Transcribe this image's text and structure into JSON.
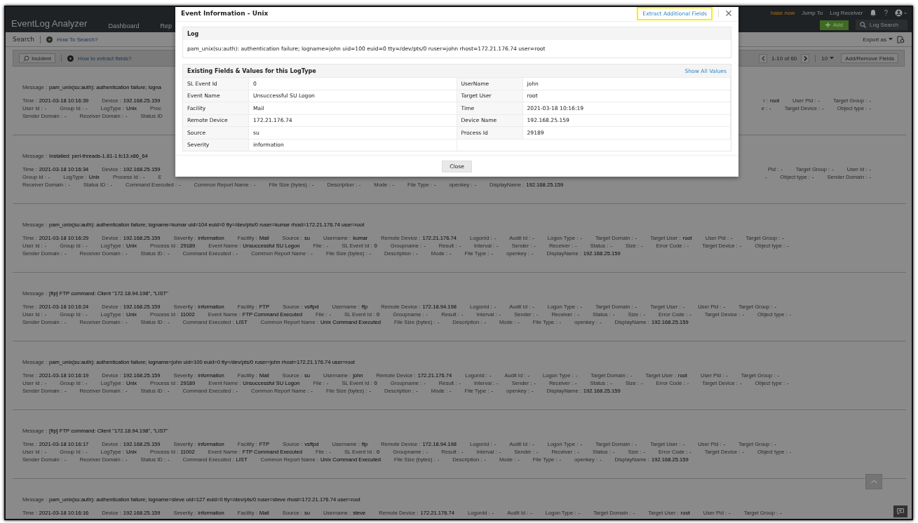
{
  "header": {
    "logo": "EventLog Analyzer",
    "nav": [
      {
        "label": "Dashboard",
        "selected": false
      },
      {
        "label": "Rep",
        "selected": false
      }
    ],
    "purchase": "hase now",
    "links": [
      "Jump To",
      "Log Receiver"
    ],
    "help": "?",
    "add_button": "Add",
    "search": {
      "placeholder": "Log Search"
    }
  },
  "search_bar": {
    "title": "Search",
    "help_link": "How To Search?",
    "export": "Export as"
  },
  "toolbar": {
    "incident": "Incident",
    "help_link": "How to extract fields?",
    "pager": "1-10 of 60",
    "page_size": "10",
    "fields_button": "Add/Remove Fields"
  },
  "events": [
    {
      "message_label": "Message :",
      "message": "pam_unix(su:auth): authentication failure; logna",
      "lines": [
        [
          [
            {
              "label": "Time :",
              "value": "2021-03-18 10:16:39"
            },
            {
              "label": "Device :",
              "value": "192.168.25.159"
            }
          ],
          [
            {
              "label": "r :",
              "value": "root"
            },
            {
              "label": "User Pid :",
              "value": "-"
            },
            {
              "label": "Target Group :",
              "value": "-"
            }
          ]
        ],
        [
          [
            {
              "label": "User Id :",
              "value": "-"
            },
            {
              "label": "Group Id :",
              "value": "-"
            },
            {
              "label": "LogType :",
              "value": "Unix"
            },
            {
              "label": "Proc"
            }
          ],
          [
            {
              "label": "e :",
              "value": "-"
            },
            {
              "label": "Target Device :",
              "value": "-"
            },
            {
              "label": "Object type :",
              "value": "-"
            }
          ]
        ],
        [
          [
            {
              "label": "Sender Domain :",
              "value": "-"
            },
            {
              "label": "Receiver Domain :",
              "value": "-"
            },
            {
              "label": "Status ID"
            }
          ]
        ]
      ]
    },
    {
      "message_label": "Message :",
      "message": "Installed: perl-threads-1.81-1.fc13.x86_64",
      "lines": [
        [
          [
            {
              "label": "Time :",
              "value": "2021-03-18 10:16:34"
            },
            {
              "label": "Device :",
              "value": "192.168.25.159"
            }
          ],
          [
            {
              "label": "Pid :",
              "value": "-"
            },
            {
              "label": "Target Group :",
              "value": "-"
            },
            {
              "label": "User Id :",
              "value": "-"
            }
          ]
        ],
        [
          [
            {
              "label": "Group Id :",
              "value": "-"
            },
            {
              "label": "LogType :",
              "value": "Unix"
            },
            {
              "label": "Process Id :",
              "value": "-"
            },
            {
              "label": "E"
            }
          ],
          [
            {
              "value": "-"
            },
            {
              "label": "Object type :",
              "value": "-"
            },
            {
              "label": "Sender Domain :",
              "value": "-"
            }
          ]
        ],
        [
          [
            {
              "label": "Receiver Domain :",
              "value": "-"
            },
            {
              "label": "Status ID :",
              "value": "-"
            },
            {
              "label": "Command Executed :",
              "value": "-"
            },
            {
              "label": "Common Report Name :",
              "value": "-"
            },
            {
              "label": "File Size (bytes) :",
              "value": "-"
            },
            {
              "label": "Description :",
              "value": "-"
            },
            {
              "label": "Mode :",
              "value": "-"
            },
            {
              "label": "File Type :",
              "value": "-"
            },
            {
              "label": "openkey :",
              "value": "-"
            },
            {
              "label": "DisplayName :",
              "value": "192.168.25.159"
            }
          ]
        ]
      ]
    },
    {
      "message_label": "Message :",
      "message": "pam_unix(su:auth): authentication failure; logname=kumar uid=104 euid=0 tty=/dev/pts/0 ruser=kumar rhost=172.21.176.74 user=root",
      "lines": [
        [
          [
            {
              "label": "Time :",
              "value": "2021-03-18 10:16:29"
            },
            {
              "label": "Device :",
              "value": "192.168.25.159"
            },
            {
              "label": "Severity :",
              "value": "information"
            },
            {
              "label": "Facility :",
              "value": "Mail"
            },
            {
              "label": "Source :",
              "value": "su"
            },
            {
              "label": "Username :",
              "value": "kumar"
            },
            {
              "label": "Remote Device :",
              "value": "172.21.176.74"
            },
            {
              "label": "LogonId :",
              "value": "-"
            },
            {
              "label": "Audit Id :",
              "value": "-"
            },
            {
              "label": "Logon Type :",
              "value": "-"
            },
            {
              "label": "Target Domain :",
              "value": "-"
            },
            {
              "label": "Target User :",
              "value": "root"
            },
            {
              "label": "User Pid :",
              "value": "-"
            },
            {
              "label": "Target Group :",
              "value": "-"
            }
          ]
        ],
        [
          [
            {
              "label": "User Id :",
              "value": "-"
            },
            {
              "label": "Group Id :",
              "value": "-"
            },
            {
              "label": "LogType :",
              "value": "Unix"
            },
            {
              "label": "Process Id :",
              "value": "29189"
            },
            {
              "label": "Event Name :",
              "value": "Unsuccessful SU Logon"
            },
            {
              "label": "File :",
              "value": "-"
            },
            {
              "label": "SL Event Id :",
              "value": "0"
            },
            {
              "label": "Groupname :",
              "value": "-"
            },
            {
              "label": "Result :",
              "value": "-"
            },
            {
              "label": "Interval :",
              "value": "-"
            },
            {
              "label": "Sender :",
              "value": "-"
            },
            {
              "label": "Receiver :",
              "value": "-"
            },
            {
              "label": "Status :",
              "value": "-"
            },
            {
              "label": "Size :",
              "value": "-"
            },
            {
              "label": "Error Code :",
              "value": "-"
            },
            {
              "label": "Target Device :",
              "value": "-"
            },
            {
              "label": "Object type :",
              "value": "-"
            }
          ]
        ],
        [
          [
            {
              "label": "Sender Domain :",
              "value": "-"
            },
            {
              "label": "Receiver Domain :",
              "value": "-"
            },
            {
              "label": "Status ID :",
              "value": "-"
            },
            {
              "label": "Command Executed :",
              "value": "-"
            },
            {
              "label": "Common Report Name :",
              "value": "-"
            },
            {
              "label": "File Size (bytes) :",
              "value": "-"
            },
            {
              "label": "Description :",
              "value": "-"
            },
            {
              "label": "Mode :",
              "value": "-"
            },
            {
              "label": "File Type :",
              "value": "-"
            },
            {
              "label": "openkey :",
              "value": "-"
            },
            {
              "label": "DisplayName :",
              "value": "192.168.25.159"
            }
          ]
        ]
      ]
    },
    {
      "message_label": "Message :",
      "message": "[ftp] FTP command: Client \"172.18.94.198\", \"LIST\"",
      "lines": [
        [
          [
            {
              "label": "Time :",
              "value": "2021-03-18 10:16:24"
            },
            {
              "label": "Device :",
              "value": "192.168.25.159"
            },
            {
              "label": "Severity :",
              "value": "information"
            },
            {
              "label": "Facility :",
              "value": "FTP"
            },
            {
              "label": "Source :",
              "value": "vsftpd"
            },
            {
              "label": "Username :",
              "value": "ftp"
            },
            {
              "label": "Remote Device :",
              "value": "172.18.94.198"
            },
            {
              "label": "LogonId :",
              "value": "-"
            },
            {
              "label": "Audit Id :",
              "value": "-"
            },
            {
              "label": "Logon Type :",
              "value": "-"
            },
            {
              "label": "Target Domain :",
              "value": "-"
            },
            {
              "label": "Target User :",
              "value": "-"
            },
            {
              "label": "User Pid :",
              "value": "-"
            },
            {
              "label": "Target Group :",
              "value": "-"
            }
          ]
        ],
        [
          [
            {
              "label": "User Id :",
              "value": "-"
            },
            {
              "label": "Group Id :",
              "value": "-"
            },
            {
              "label": "LogType :",
              "value": "Unix"
            },
            {
              "label": "Process Id :",
              "value": "11002"
            },
            {
              "label": "Event Name :",
              "value": "FTP Command Executed"
            },
            {
              "label": "File :",
              "value": "-"
            },
            {
              "label": "SL Event Id :",
              "value": "0"
            },
            {
              "label": "Groupname :",
              "value": "-"
            },
            {
              "label": "Result :",
              "value": "-"
            },
            {
              "label": "Interval :",
              "value": "-"
            },
            {
              "label": "Sender :",
              "value": "-"
            },
            {
              "label": "Receiver :",
              "value": "-"
            },
            {
              "label": "Status :",
              "value": "-"
            },
            {
              "label": "Size :",
              "value": "-"
            },
            {
              "label": "Error Code :",
              "value": "-"
            },
            {
              "label": "Target Device :",
              "value": "-"
            },
            {
              "label": "Object type :",
              "value": "-"
            }
          ]
        ],
        [
          [
            {
              "label": "Sender Domain :",
              "value": "-"
            },
            {
              "label": "Receiver Domain :",
              "value": "-"
            },
            {
              "label": "Status ID :",
              "value": "-"
            },
            {
              "label": "Command Executed :",
              "value": "LIST"
            },
            {
              "label": "Common Report Name :",
              "value": "Unix Command Executed"
            },
            {
              "label": "File Size (bytes) :",
              "value": "-"
            },
            {
              "label": "Description :",
              "value": "-"
            },
            {
              "label": "Mode :",
              "value": "-"
            },
            {
              "label": "File Type :",
              "value": "-"
            },
            {
              "label": "openkey :",
              "value": "-"
            },
            {
              "label": "DisplayName :",
              "value": "192.168.25.159"
            }
          ]
        ]
      ]
    },
    {
      "message_label": "Message :",
      "message": "pam_unix(su:auth): authentication failure; logname=john uid=100 euid=0 tty=/dev/pts/0 ruser=john rhost=172.21.176.74 user=root",
      "lines": [
        [
          [
            {
              "label": "Time :",
              "value": "2021-03-18 10:16:19"
            },
            {
              "label": "Device :",
              "value": "192.168.25.159"
            },
            {
              "label": "Severity :",
              "value": "information"
            },
            {
              "label": "Facility :",
              "value": "Mail"
            },
            {
              "label": "Source :",
              "value": "su"
            },
            {
              "label": "Username :",
              "value": "john"
            },
            {
              "label": "Remote Device :",
              "value": "172.21.176.74"
            },
            {
              "label": "LogonId :",
              "value": "-"
            },
            {
              "label": "Audit Id :",
              "value": "-"
            },
            {
              "label": "Logon Type :",
              "value": "-"
            },
            {
              "label": "Target Domain :",
              "value": "-"
            },
            {
              "label": "Target User :",
              "value": "root"
            },
            {
              "label": "User Pid :",
              "value": "-"
            },
            {
              "label": "Target Group :",
              "value": "-"
            }
          ]
        ],
        [
          [
            {
              "label": "User Id :",
              "value": "-"
            },
            {
              "label": "Group Id :",
              "value": "-"
            },
            {
              "label": "LogType :",
              "value": "Unix"
            },
            {
              "label": "Process Id :",
              "value": "29189"
            },
            {
              "label": "Event Name :",
              "value": "Unsuccessful SU Logon"
            },
            {
              "label": "File :",
              "value": "-"
            },
            {
              "label": "SL Event Id :",
              "value": "0"
            },
            {
              "label": "Groupname :",
              "value": "-"
            },
            {
              "label": "Result :",
              "value": "-"
            },
            {
              "label": "Interval :",
              "value": "-"
            },
            {
              "label": "Sender :",
              "value": "-"
            },
            {
              "label": "Receiver :",
              "value": "-"
            },
            {
              "label": "Status :",
              "value": "-"
            },
            {
              "label": "Size :",
              "value": "-"
            },
            {
              "label": "Error Code :",
              "value": "-"
            },
            {
              "label": "Target Device :",
              "value": "-"
            },
            {
              "label": "Object type :",
              "value": "-"
            }
          ]
        ],
        [
          [
            {
              "label": "Sender Domain :",
              "value": "-"
            },
            {
              "label": "Receiver Domain :",
              "value": "-"
            },
            {
              "label": "Status ID :",
              "value": "-"
            },
            {
              "label": "Command Executed :",
              "value": "-"
            },
            {
              "label": "Common Report Name :",
              "value": "-"
            },
            {
              "label": "File Size (bytes) :",
              "value": "-"
            },
            {
              "label": "Description :",
              "value": "-"
            },
            {
              "label": "Mode :",
              "value": "-"
            },
            {
              "label": "File Type :",
              "value": "-"
            },
            {
              "label": "openkey :",
              "value": "-"
            },
            {
              "label": "DisplayName :",
              "value": "192.168.25.159"
            }
          ]
        ]
      ]
    },
    {
      "message_label": "Message :",
      "message": "[ftp] FTP command: Client \"172.18.94.198\", \"LIST\"",
      "lines": [
        [
          [
            {
              "label": "Time :",
              "value": "2021-03-18 10:16:17"
            },
            {
              "label": "Device :",
              "value": "192.168.25.159"
            },
            {
              "label": "Severity :",
              "value": "information"
            },
            {
              "label": "Facility :",
              "value": "FTP"
            },
            {
              "label": "Source :",
              "value": "vsftpd"
            },
            {
              "label": "Username :",
              "value": "ftp"
            },
            {
              "label": "Remote Device :",
              "value": "172.18.94.198"
            },
            {
              "label": "LogonId :",
              "value": "-"
            },
            {
              "label": "Audit Id :",
              "value": "-"
            },
            {
              "label": "Logon Type :",
              "value": "-"
            },
            {
              "label": "Target Domain :",
              "value": "-"
            },
            {
              "label": "Target User :",
              "value": "-"
            },
            {
              "label": "User Pid :",
              "value": "-"
            },
            {
              "label": "Target Group :",
              "value": "-"
            }
          ]
        ],
        [
          [
            {
              "label": "User Id :",
              "value": "-"
            },
            {
              "label": "Group Id :",
              "value": "-"
            },
            {
              "label": "LogType :",
              "value": "Unix"
            },
            {
              "label": "Process Id :",
              "value": "11002"
            },
            {
              "label": "Event Name :",
              "value": "FTP Command Executed"
            },
            {
              "label": "File :",
              "value": "-"
            },
            {
              "label": "SL Event Id :",
              "value": "0"
            },
            {
              "label": "Groupname :",
              "value": "-"
            },
            {
              "label": "Result :",
              "value": "-"
            },
            {
              "label": "Interval :",
              "value": "-"
            },
            {
              "label": "Sender :",
              "value": "-"
            },
            {
              "label": "Receiver :",
              "value": "-"
            },
            {
              "label": "Status :",
              "value": "-"
            },
            {
              "label": "Size :",
              "value": "-"
            },
            {
              "label": "Error Code :",
              "value": "-"
            },
            {
              "label": "Target Device :",
              "value": "-"
            },
            {
              "label": "Object type :",
              "value": "-"
            }
          ]
        ],
        [
          [
            {
              "label": "Sender Domain :",
              "value": "-"
            },
            {
              "label": "Receiver Domain :",
              "value": "-"
            },
            {
              "label": "Status ID :",
              "value": "-"
            },
            {
              "label": "Command Executed :",
              "value": "LIST"
            },
            {
              "label": "Common Report Name :",
              "value": "Unix Command Executed"
            },
            {
              "label": "File Size (bytes) :",
              "value": "-"
            },
            {
              "label": "Description :",
              "value": "-"
            },
            {
              "label": "Mode :",
              "value": "-"
            },
            {
              "label": "File Type :",
              "value": "-"
            },
            {
              "label": "openkey :",
              "value": "-"
            },
            {
              "label": "DisplayName :",
              "value": "192.168.25.159"
            }
          ]
        ]
      ]
    },
    {
      "message_label": "Message :",
      "message": "pam_unix(su:auth): authentication failure; logname=steve uid=127 euid=0 tty=/dev/pts/0 ruser=steve rhost=172.21.176.74 user=root",
      "lines": [
        [
          [
            {
              "label": "Time :",
              "value": "2021-03-18 10:16:16"
            },
            {
              "label": "Device :",
              "value": "192.168.25.159"
            },
            {
              "label": "Severity :",
              "value": "information"
            },
            {
              "label": "Facility :",
              "value": "Mail"
            },
            {
              "label": "Source :",
              "value": "su"
            },
            {
              "label": "Username :",
              "value": "steve"
            },
            {
              "label": "Remote Device :",
              "value": "172.21.176.74"
            },
            {
              "label": "LogonId :",
              "value": "-"
            },
            {
              "label": "Audit Id :",
              "value": "-"
            },
            {
              "label": "Logon Type :",
              "value": "-"
            },
            {
              "label": "Target Domain :",
              "value": "-"
            },
            {
              "label": "Target User :",
              "value": "root"
            },
            {
              "label": "User Pid :",
              "value": "-"
            },
            {
              "label": "Target Group :",
              "value": "-"
            }
          ]
        ]
      ]
    }
  ],
  "modal": {
    "title": "Event Information - Unix",
    "extract_link": {
      "label": "Extract Additional Fields",
      "highlighted": true
    },
    "log": {
      "title": "Log",
      "text": "pam_unix(su:auth): authentication failure; logname=john uid=100 euid=0 tty=/dev/pts/0 ruser=john rhost=172.21.176.74 user=root"
    },
    "fields_title": "Existing Fields & Values for this LogType",
    "show_all_link": "Show All Values",
    "fields": [
      {
        "label": "SL Event Id",
        "value": "0"
      },
      {
        "label": "UserName",
        "value": "john"
      },
      {
        "label": "Event Name",
        "value": "Unsuccessful SU Logon"
      },
      {
        "label": "Target User",
        "value": "root"
      },
      {
        "label": "Facility",
        "value": "Mail"
      },
      {
        "label": "Time",
        "value": "2021-03-18 10:16:19"
      },
      {
        "label": "Remote Device",
        "value": "172.21.176.74"
      },
      {
        "label": "Device Name",
        "value": "192.168.25.159"
      },
      {
        "label": "Source",
        "value": "su"
      },
      {
        "label": "Process Id",
        "value": "29189"
      },
      {
        "label": "Severity",
        "value": "information"
      }
    ],
    "close_button": "Close"
  }
}
